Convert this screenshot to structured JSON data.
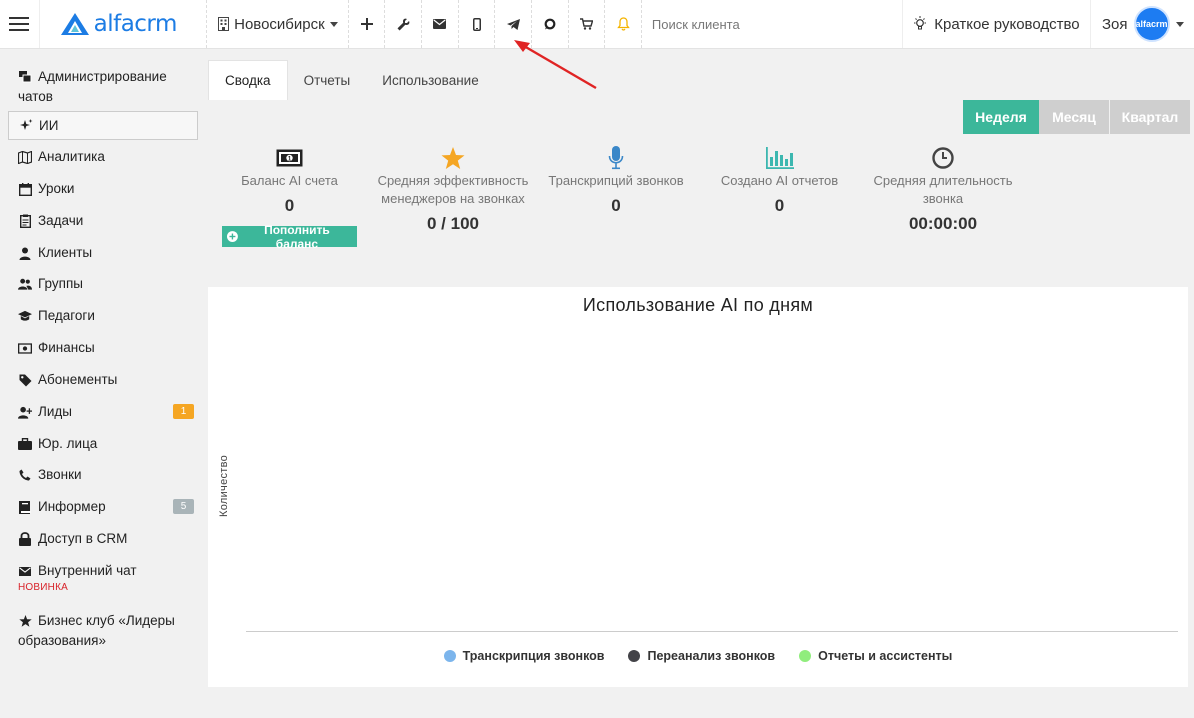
{
  "header": {
    "logo_text": "alfacrm",
    "city": "Новосибирск",
    "search_placeholder": "Поиск клиента",
    "guide_label": "Краткое руководство",
    "user_name": "Зоя",
    "avatar_text": "alfacrm"
  },
  "sidebar": {
    "items": [
      {
        "label": "Администрирование чатов",
        "icon": "chats-icon"
      },
      {
        "label": "ИИ",
        "icon": "sparkle-icon"
      },
      {
        "label": "Аналитика",
        "icon": "map-icon"
      },
      {
        "label": "Уроки",
        "icon": "calendar-icon"
      },
      {
        "label": "Задачи",
        "icon": "clipboard-icon"
      },
      {
        "label": "Клиенты",
        "icon": "user-icon"
      },
      {
        "label": "Группы",
        "icon": "users-icon"
      },
      {
        "label": "Педагоги",
        "icon": "graduation-cap-icon"
      },
      {
        "label": "Финансы",
        "icon": "money-icon"
      },
      {
        "label": "Абонементы",
        "icon": "tag-icon"
      },
      {
        "label": "Лиды",
        "icon": "user-plus-icon",
        "badge": "1"
      },
      {
        "label": "Юр. лица",
        "icon": "briefcase-icon"
      },
      {
        "label": "Звонки",
        "icon": "phone-icon"
      },
      {
        "label": "Информер",
        "icon": "book-icon",
        "badge": "5"
      },
      {
        "label": "Доступ в CRM",
        "icon": "lock-icon"
      },
      {
        "label": "Внутренний чат",
        "icon": "envelope-icon",
        "tag": "НОВИНКА"
      },
      {
        "label": "Бизнес клуб «Лидеры образования»",
        "icon": "star-icon"
      }
    ]
  },
  "tabs": [
    {
      "label": "Сводка",
      "active": true
    },
    {
      "label": "Отчеты",
      "active": false
    },
    {
      "label": "Использование",
      "active": false
    }
  ],
  "period": {
    "week": "Неделя",
    "month": "Месяц",
    "quarter": "Квартал"
  },
  "stats": {
    "balance": {
      "label": "Баланс AI счета",
      "value": "0",
      "button": "Пополнить баланс"
    },
    "efficiency": {
      "label": "Средняя эффективность менеджеров на звонках",
      "value": "0 / 100"
    },
    "transcripts": {
      "label": "Транскрипций звонков",
      "value": "0"
    },
    "reports": {
      "label": "Создано AI отчетов",
      "value": "0"
    },
    "duration": {
      "label": "Средняя длительность звонка",
      "value": "00:00:00"
    }
  },
  "chart_data": {
    "type": "bar",
    "title": "Использование AI по дням",
    "xlabel": "",
    "ylabel": "Количество",
    "categories": [],
    "series": [
      {
        "name": "Транскрипция звонков",
        "color": "#7cb5ec",
        "values": []
      },
      {
        "name": "Переанализ звонков",
        "color": "#434348",
        "values": []
      },
      {
        "name": "Отчеты и ассистенты",
        "color": "#90ed7d",
        "values": []
      }
    ],
    "legend": "bottom"
  },
  "colors": {
    "accent": "#3cb79a",
    "brand": "#1c7ce4",
    "badge_orange": "#f5a623",
    "badge_gray": "#a9b4b8",
    "arrow": "#e02424"
  }
}
